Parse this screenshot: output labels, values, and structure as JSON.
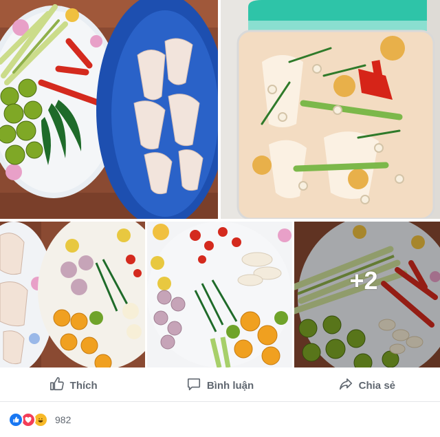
{
  "post": {
    "photos": [
      {
        "name": "lemongrass-chili-lime-plate"
      },
      {
        "name": "chicken-feet-basket"
      },
      {
        "name": "pickled-chicken-feet-jar"
      },
      {
        "name": "chicken-feet-plate"
      },
      {
        "name": "chopped-ingredients-plate"
      },
      {
        "name": "lemongrass-chili-plate"
      }
    ],
    "more_photos_label": "+2"
  },
  "actions": {
    "like_label": "Thích",
    "comment_label": "Bình luận",
    "share_label": "Chia sẻ"
  },
  "reactions": {
    "icons": [
      "like-icon",
      "love-icon",
      "haha-icon"
    ],
    "colors": {
      "like": "#1877f2",
      "love": "#f33e58",
      "haha": "#f7b928"
    },
    "count": "982"
  }
}
